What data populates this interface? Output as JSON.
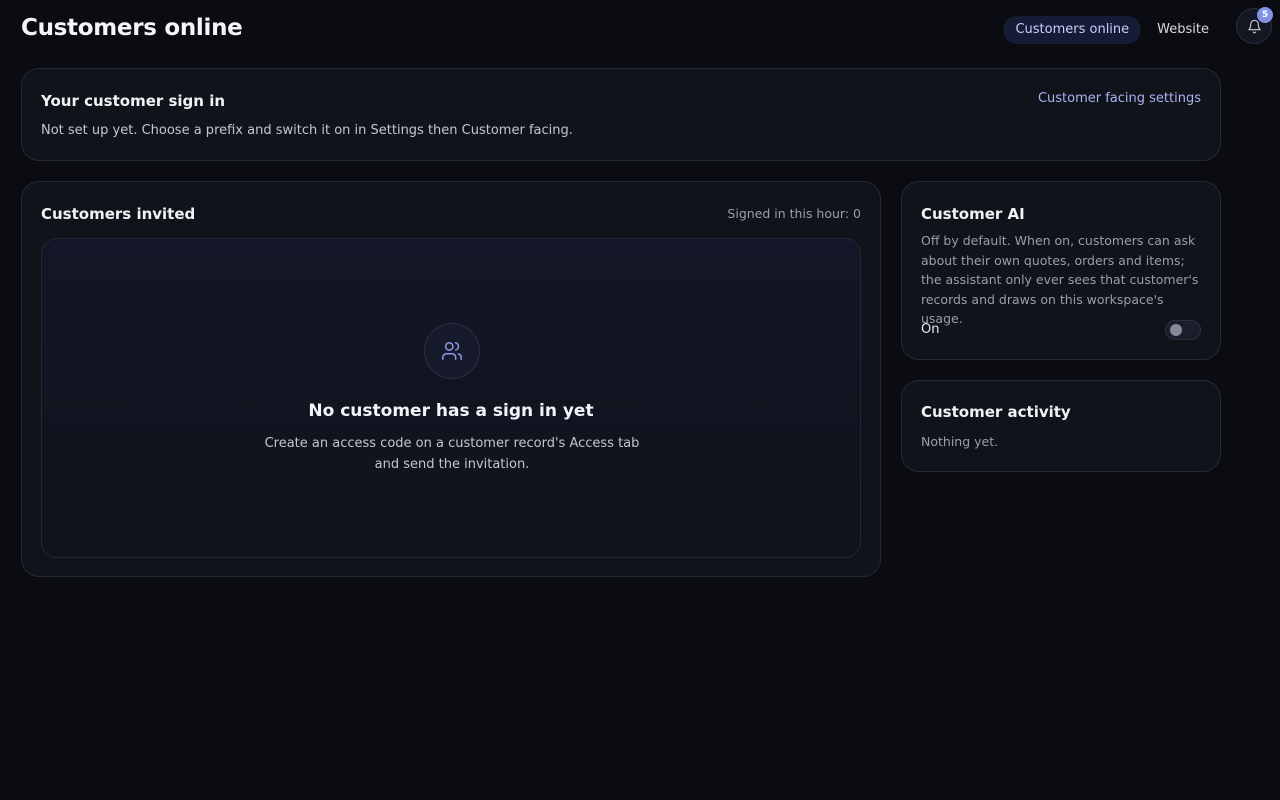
{
  "header": {
    "title": "Customers online",
    "tabs": [
      {
        "label": "Customers online",
        "active": true
      },
      {
        "label": "Website",
        "active": false
      }
    ],
    "notifications": {
      "count": "5",
      "icon": "bell-icon"
    }
  },
  "signin": {
    "title": "Your customer sign in",
    "description": "Not set up yet. Choose a prefix and switch it on in Settings then Customer facing.",
    "settings_link": "Customer facing settings"
  },
  "invited": {
    "title": "Customers invited",
    "status": "Signed in this hour: 0",
    "empty": {
      "icon": "users-icon",
      "title": "No customer has a sign in yet",
      "description": "Create an access code on a customer record's Access tab and send the invitation."
    }
  },
  "ai": {
    "title": "Customer AI",
    "description": "Off by default. When on, customers can ask about their own quotes, orders and items; the assistant only ever sees that customer's records and draws on this workspace's usage.",
    "toggle_label": "On",
    "toggle_on": false
  },
  "activity": {
    "title": "Customer activity",
    "text": "Nothing yet."
  },
  "colors": {
    "background": "#0b0c11",
    "card": "#11131b",
    "accent": "#8191e6",
    "link": "#a8b3f2"
  }
}
